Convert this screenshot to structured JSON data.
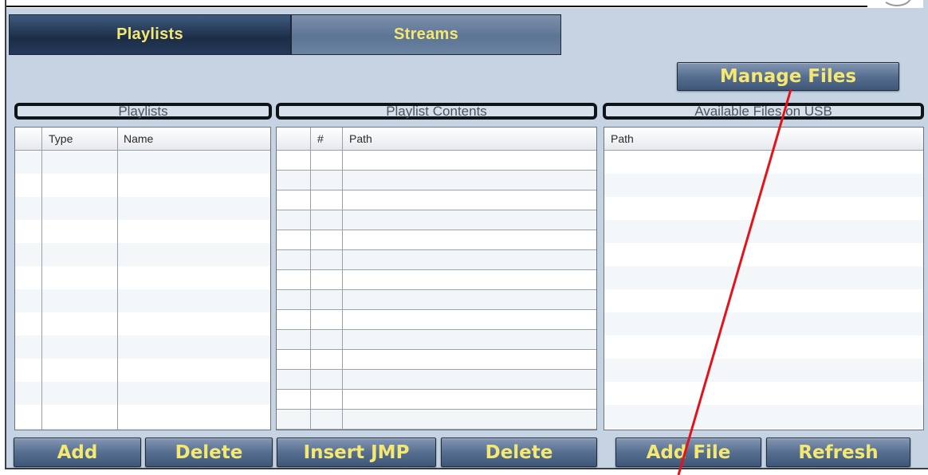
{
  "tabs": [
    {
      "label": "Playlists",
      "active": true
    },
    {
      "label": "Streams",
      "active": false
    }
  ],
  "manage_files_label": "Manage Files",
  "sections": {
    "playlists": {
      "title": "Playlists",
      "columns": [
        "",
        "Type",
        "Name"
      ]
    },
    "contents": {
      "title": "Playlist Contents",
      "columns": [
        "",
        "#",
        "Path"
      ]
    },
    "usb": {
      "title": "Available Files on USB",
      "columns": [
        "Path"
      ]
    }
  },
  "buttons": {
    "playlists_add": "Add",
    "playlists_delete": "Delete",
    "contents_insert_jmp": "Insert JMP",
    "contents_delete": "Delete",
    "usb_add_file": "Add File",
    "usb_refresh": "Refresh"
  },
  "colors": {
    "button_text": "#f4e872",
    "panel_background": "#c5d3e3",
    "annotation_arrow": "#e4131b"
  }
}
